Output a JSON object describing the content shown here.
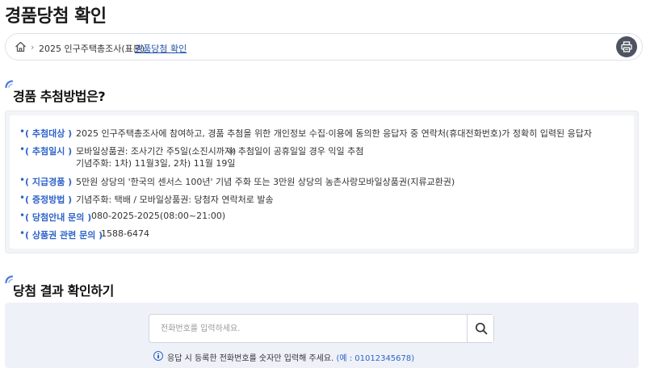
{
  "page": {
    "title": "경품당첨 확인"
  },
  "breadcrumb": {
    "home_icon": "home-icon",
    "items": [
      "2025 인구주택총조사(표본)",
      "경품당첨 확인"
    ],
    "print_icon": "printer-icon"
  },
  "method": {
    "title": "경품 추첨방법은?",
    "rows": [
      {
        "label": "( 추첨대상 )",
        "value": "2025 인구주택총조사에 참여하고, 경품 추첨을 위한 개인정보 수집·이용에 동의한 응답자 중 연락처(휴대전화번호)가 정확히 입력된 응답자"
      },
      {
        "label": "( 추첨일시 )",
        "value": "모바일상품권: 조사기간 주5일(소진시까지)",
        "note": "※ 추첨일이 공휴일일 경우 익일 추첨",
        "value2": "기념주화: 1차) 11월3일, 2차) 11월 19일"
      },
      {
        "label": "( 지급경품 )",
        "value": "5만원 상당의 '한국의 센서스 100년' 기념 주화 또는 3만원 상당의 농촌사랑모바일상품권(지류교환권)"
      },
      {
        "label": "( 증정방법 )",
        "value": "기념주화: 택배 / 모바일상품권: 당첨자 연락처로 발송"
      },
      {
        "label": "( 당첨안내 문의 )",
        "value": "080-2025-2025(08:00~21:00)"
      },
      {
        "label": "( 상품권 관련 문의 )",
        "value": "1588-6474"
      }
    ]
  },
  "result": {
    "title": "당첨 결과 확인하기",
    "search": {
      "placeholder": "전화번호를 입력하세요.",
      "value": ""
    },
    "search_icon": "search-icon",
    "notice": {
      "icon": "info-icon",
      "text": "응답 시 등록한 전화번호를 숫자만 입력해 주세요. ",
      "example": "(예 : 01012345678)"
    }
  },
  "colors": {
    "accent": "#2f64c9",
    "link": "#2352a8",
    "panel_bg": "#f2f4f8",
    "result_bg": "#eef1f8",
    "print_btn": "#4d5360"
  }
}
